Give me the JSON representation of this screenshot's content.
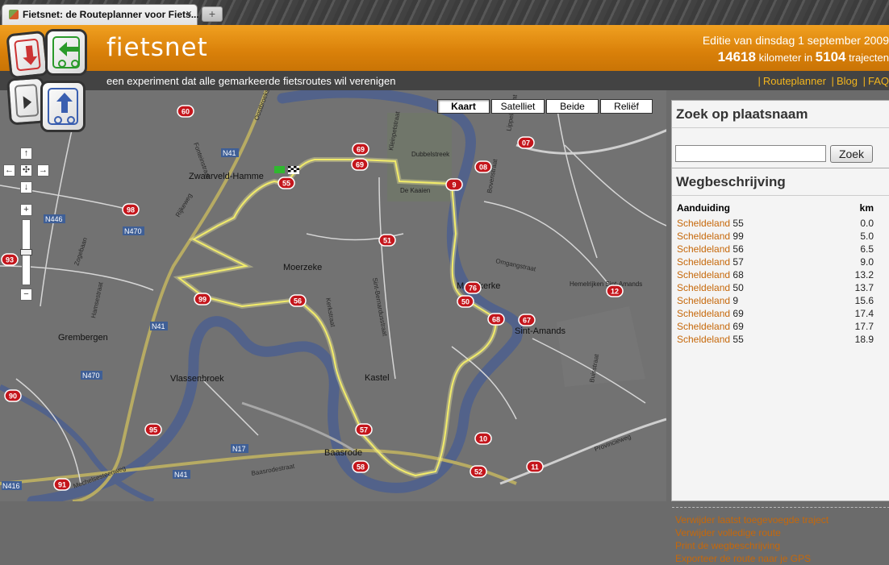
{
  "browser": {
    "tab_title": "Fietsnet: de Routeplanner voor Fiets...",
    "close_glyph": "×",
    "newtab_glyph": "+"
  },
  "header": {
    "brand": "fietsnet",
    "edition": "Editie van dinsdag 1 september 2009",
    "km_count": "14618",
    "km_label": "kilometer in",
    "route_count": "5104",
    "route_label": "trajecten",
    "tagline": "een experiment dat alle gemarkeerde fietsroutes wil verenigen",
    "nav": [
      "Routeplanner",
      "Blog",
      "FAQ"
    ]
  },
  "map": {
    "types": [
      "Kaart",
      "Satelliet",
      "Beide",
      "Reliëf"
    ],
    "active_type": "Kaart",
    "town_labels": [
      "Zwaarveld-Hamme",
      "Moerzeke",
      "Grembergen",
      "Vlassenbroek",
      "Kastel",
      "Baasrode",
      "Mariekerke",
      "Sint-Amands",
      "Dubbelstreek",
      "De Kaaien",
      "Hemelrijken Sint-Amands"
    ],
    "road_labels": [
      "N41",
      "N470",
      "N446",
      "N17",
      "N416",
      "Rijkeweg",
      "Zogebaan",
      "Hamsestraat",
      "Mechelsesteenweg",
      "Baasrodestraat",
      "Provincieweg",
      "Omgangstraat",
      "Kleinpetstraat",
      "Sint-Bernardusstraat",
      "Kerkstraat",
      "Lippelostraat",
      "Bovenstraat",
      "Buisstraat",
      "Fonteinstraat",
      "Oostbroekstraat"
    ],
    "node_markers": [
      "60",
      "69",
      "69",
      "55",
      "07",
      "08",
      "9",
      "98",
      "93",
      "51",
      "99",
      "56",
      "76",
      "50",
      "68",
      "67",
      "12",
      "90",
      "95",
      "57",
      "10",
      "58",
      "52",
      "11",
      "91"
    ],
    "controls": {
      "up": "↑",
      "left": "←",
      "center": "✣",
      "right": "→",
      "down": "↓",
      "zoom_in": "+",
      "zoom_out": "−"
    }
  },
  "search": {
    "heading": "Zoek op plaatsnaam",
    "placeholder": "",
    "value": "",
    "button": "Zoek"
  },
  "route": {
    "heading": "Wegbeschrijving",
    "col_label": "Aanduiding",
    "col_km": "km",
    "rows": [
      {
        "name": "Scheldeland",
        "node": "55",
        "km": "0.0"
      },
      {
        "name": "Scheldeland",
        "node": "99",
        "km": "5.0"
      },
      {
        "name": "Scheldeland",
        "node": "56",
        "km": "6.5"
      },
      {
        "name": "Scheldeland",
        "node": "57",
        "km": "9.0"
      },
      {
        "name": "Scheldeland",
        "node": "68",
        "km": "13.2"
      },
      {
        "name": "Scheldeland",
        "node": "50",
        "km": "13.7"
      },
      {
        "name": "Scheldeland",
        "node": "9",
        "km": "15.6"
      },
      {
        "name": "Scheldeland",
        "node": "69",
        "km": "17.4"
      },
      {
        "name": "Scheldeland",
        "node": "69",
        "km": "17.7"
      },
      {
        "name": "Scheldeland",
        "node": "55",
        "km": "18.9"
      }
    ],
    "actions": [
      "Verwijder laatst toegevoegde traject",
      "Verwijder volledige route",
      "Print de wegbeschrijving",
      "Exporteer de route naar je GPS"
    ]
  },
  "colors": {
    "header_orange": "#d98009",
    "link_orange": "#c6680a",
    "route_yellow": "#f2ec6a",
    "river": "#52628a",
    "marker_red": "#c4161c"
  }
}
